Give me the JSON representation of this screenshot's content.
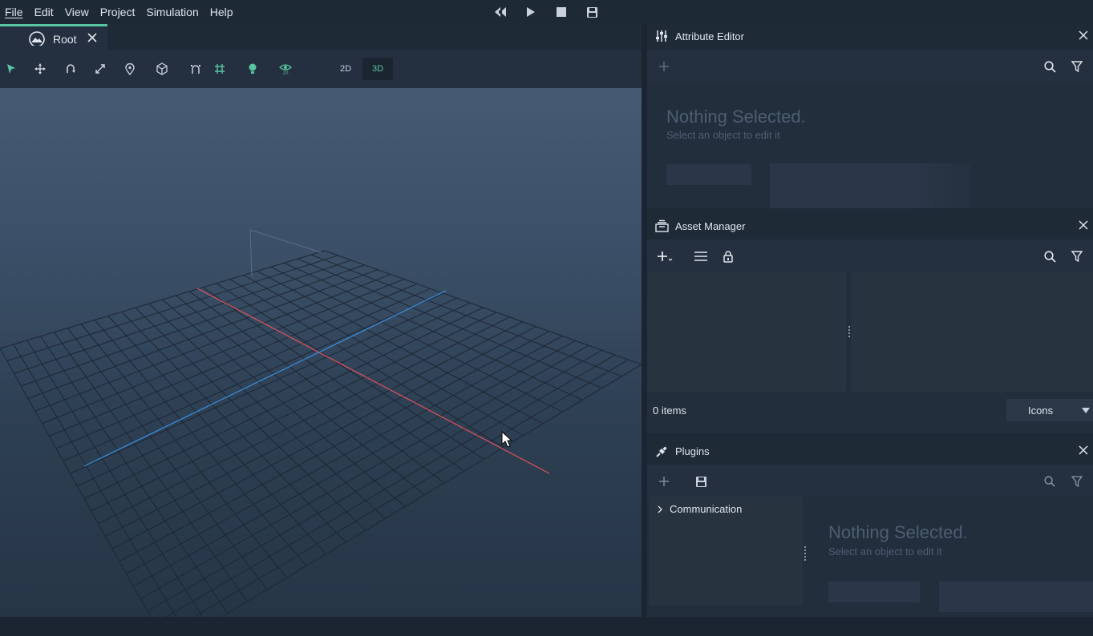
{
  "menu": {
    "items": [
      {
        "id": "file",
        "label": "File"
      },
      {
        "id": "edit",
        "label": "Edit"
      },
      {
        "id": "view",
        "label": "View"
      },
      {
        "id": "project",
        "label": "Project"
      },
      {
        "id": "simulation",
        "label": "Simulation"
      },
      {
        "id": "help",
        "label": "Help"
      }
    ]
  },
  "simulation_controls": [
    "rewind-icon",
    "play-icon",
    "stop-icon",
    "save-icon"
  ],
  "viewport": {
    "tab_label": "Root",
    "toolbar_icons": [
      "select-arrow-icon",
      "move-icon",
      "rotate-icon",
      "scale-icon",
      "pin-icon",
      "cube-icon",
      "snap-icon",
      "grid-icon",
      "light-bulb-icon",
      "eye-2d-icon"
    ],
    "mode_2d": "2D",
    "mode_3d": "3D",
    "active_mode": "3D",
    "x_axis_color": "#e0505a",
    "z_axis_color": "#3a8fe0",
    "accent_color": "#58c4a0"
  },
  "attribute_editor": {
    "title": "Attribute Editor",
    "nothing_title": "Nothing Selected.",
    "nothing_sub": "Select an object to edit it"
  },
  "asset_manager": {
    "title": "Asset Manager",
    "items_count": "0 items",
    "view_mode": "Icons"
  },
  "plugins": {
    "title": "Plugins",
    "tree": [
      {
        "label": "Communication"
      }
    ],
    "nothing_title": "Nothing Selected.",
    "nothing_sub": "Select an object to edit it"
  }
}
